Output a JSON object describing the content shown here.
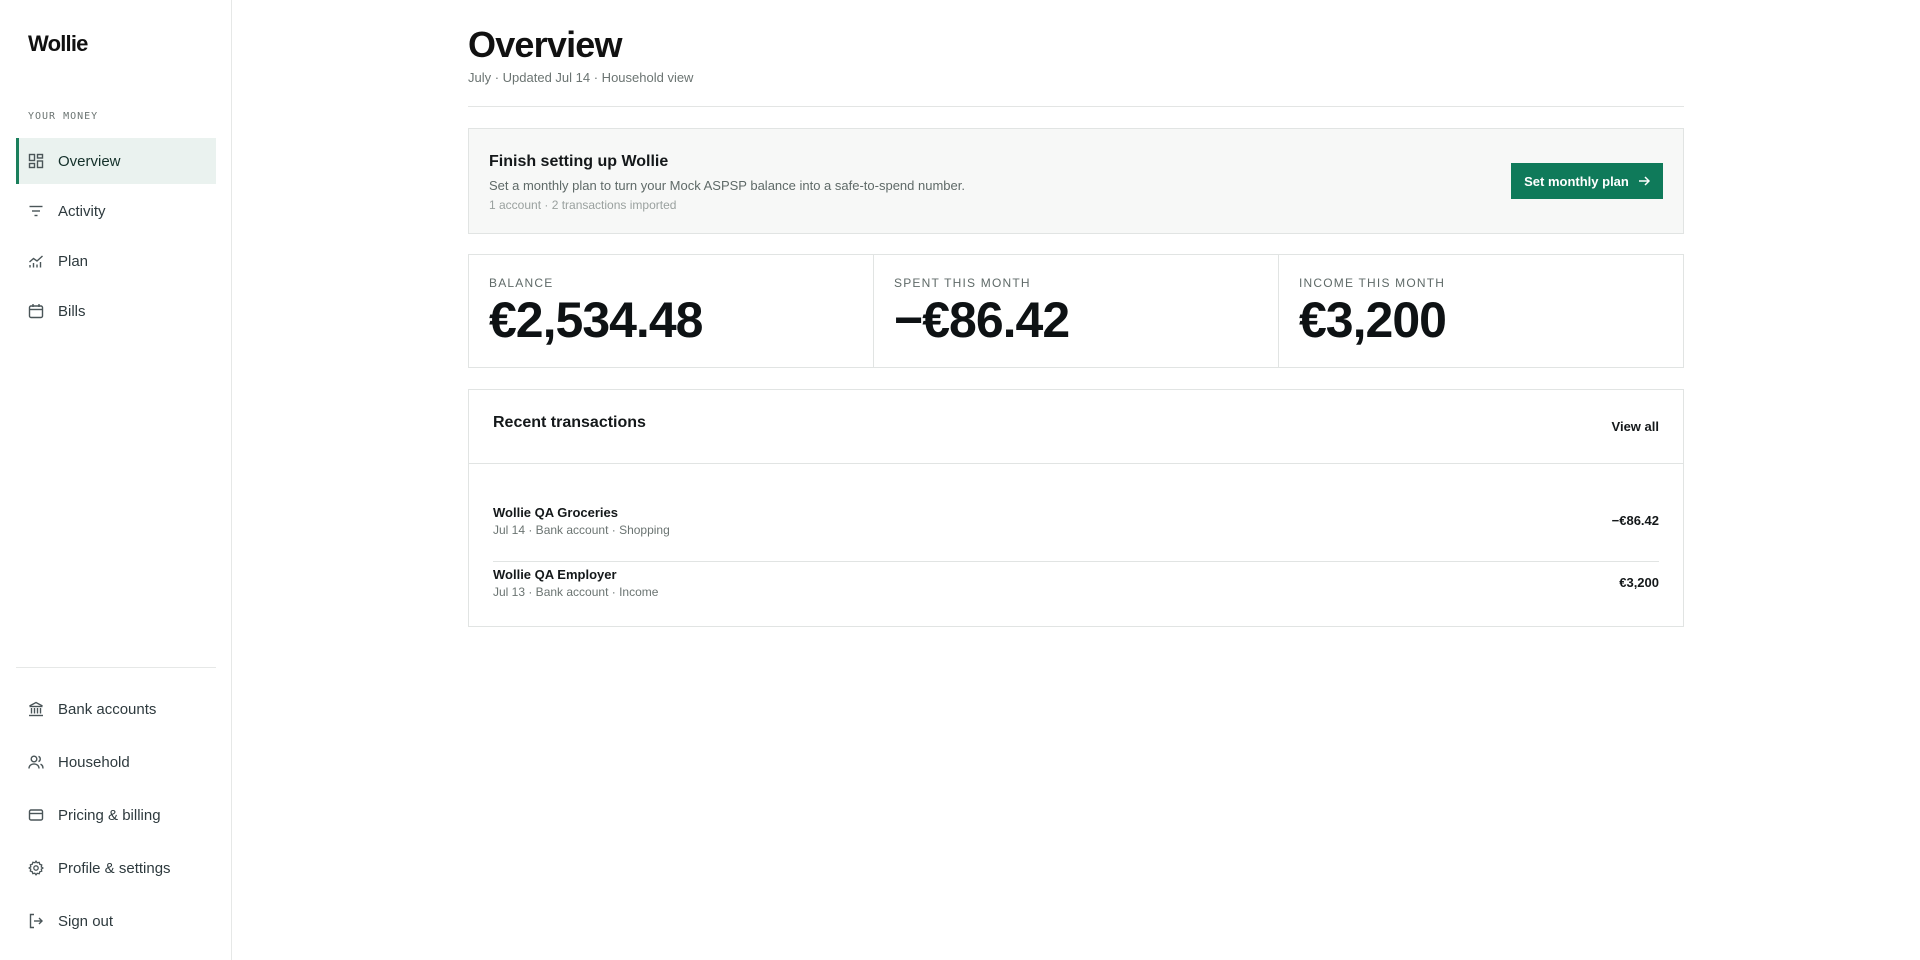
{
  "app": {
    "logo": "Wollie"
  },
  "sidebar": {
    "section_label": "YOUR MONEY",
    "items": [
      {
        "label": "Overview",
        "icon": "grid-icon",
        "active": true
      },
      {
        "label": "Activity",
        "icon": "filter-lines-icon"
      },
      {
        "label": "Plan",
        "icon": "chart-icon"
      },
      {
        "label": "Bills",
        "icon": "calendar-icon"
      }
    ],
    "bottom_items": [
      {
        "label": "Bank accounts",
        "icon": "bank-icon"
      },
      {
        "label": "Household",
        "icon": "users-icon"
      },
      {
        "label": "Pricing & billing",
        "icon": "credit-card-icon"
      },
      {
        "label": "Profile & settings",
        "icon": "gear-icon"
      },
      {
        "label": "Sign out",
        "icon": "sign-out-icon"
      }
    ]
  },
  "header": {
    "title": "Overview",
    "subtitle": "July · Updated Jul 14 · Household view"
  },
  "setup": {
    "title": "Finish setting up Wollie",
    "description": "Set a monthly plan to turn your Mock ASPSP balance into a safe-to-spend number.",
    "meta": "1 account · 2 transactions imported",
    "button_label": "Set monthly plan"
  },
  "stats": [
    {
      "label": "BALANCE",
      "value": "€2,534.48"
    },
    {
      "label": "SPENT THIS MONTH",
      "value": "−€86.42"
    },
    {
      "label": "INCOME THIS MONTH",
      "value": "€3,200"
    }
  ],
  "transactions": {
    "title": "Recent transactions",
    "view_all_label": "View all",
    "rows": [
      {
        "name": "Wollie QA Groceries",
        "meta": "Jul 14 · Bank account · Shopping",
        "amount": "−€86.42"
      },
      {
        "name": "Wollie QA Employer",
        "meta": "Jul 13 · Bank account · Income",
        "amount": "€3,200"
      }
    ]
  },
  "colors": {
    "accent": "#0f7a5a",
    "active_bg": "#eaf2ef"
  }
}
